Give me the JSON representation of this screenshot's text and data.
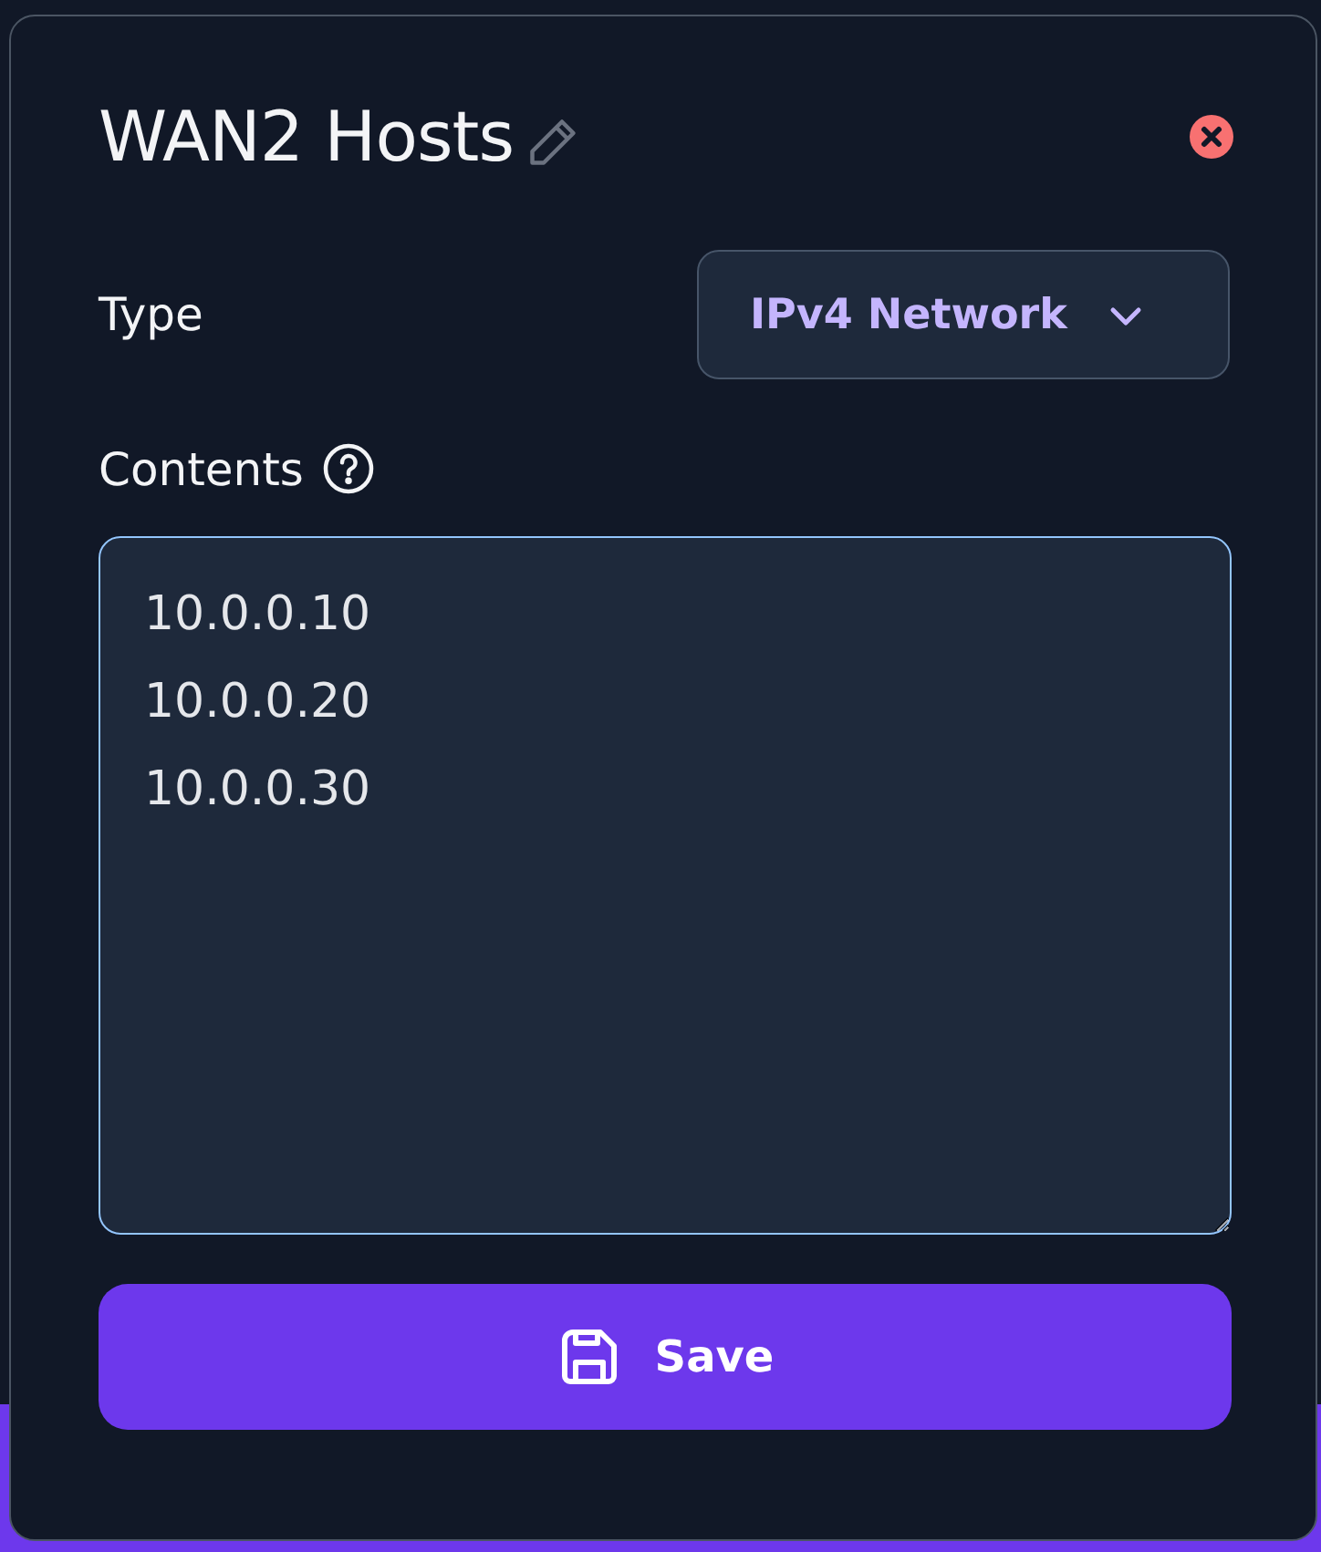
{
  "dialog": {
    "title": "WAN2 Hosts",
    "type_field": {
      "label": "Type",
      "value": "IPv4 Network"
    },
    "contents_field": {
      "label": "Contents",
      "value": "10.0.0.10\n10.0.0.20\n10.0.0.30",
      "focused": true
    },
    "save_button": {
      "label": "Save"
    }
  }
}
